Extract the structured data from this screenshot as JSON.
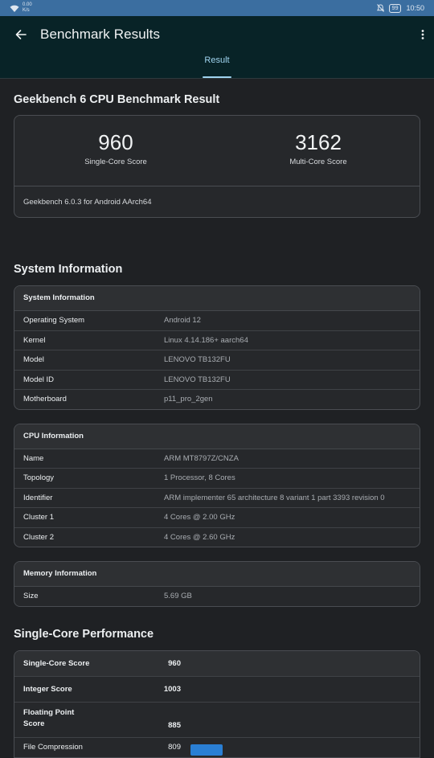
{
  "status": {
    "net_speed": "0.00",
    "net_unit": "K/s",
    "battery": "99",
    "time": "10:50"
  },
  "header": {
    "title": "Benchmark Results",
    "tab": "Result"
  },
  "result": {
    "heading": "Geekbench 6 CPU Benchmark Result",
    "single_score": "960",
    "single_label": "Single-Core Score",
    "multi_score": "3162",
    "multi_label": "Multi-Core Score",
    "version": "Geekbench 6.0.3 for Android AArch64"
  },
  "system": {
    "heading": "System Information",
    "card_title": "System Information",
    "rows": [
      {
        "k": "Operating System",
        "v": "Android 12"
      },
      {
        "k": "Kernel",
        "v": "Linux 4.14.186+ aarch64"
      },
      {
        "k": "Model",
        "v": "LENOVO TB132FU"
      },
      {
        "k": "Model ID",
        "v": "LENOVO TB132FU"
      },
      {
        "k": "Motherboard",
        "v": "p11_pro_2gen"
      }
    ]
  },
  "cpu": {
    "card_title": "CPU Information",
    "rows": [
      {
        "k": "Name",
        "v": "ARM MT8797Z/CNZA"
      },
      {
        "k": "Topology",
        "v": "1 Processor, 8 Cores"
      },
      {
        "k": "Identifier",
        "v": "ARM implementer 65 architecture 8 variant 1 part 3393 revision 0"
      },
      {
        "k": "Cluster 1",
        "v": "4 Cores @ 2.00 GHz"
      },
      {
        "k": "Cluster 2",
        "v": "4 Cores @ 2.60 GHz"
      }
    ]
  },
  "memory": {
    "card_title": "Memory Information",
    "rows": [
      {
        "k": "Size",
        "v": "5.69 GB"
      }
    ]
  },
  "single_core": {
    "heading": "Single-Core Performance",
    "rows": [
      {
        "k": "Single-Core Score",
        "v": "960"
      },
      {
        "k": "Integer Score",
        "v": "1003"
      },
      {
        "k": "Floating Point Score",
        "k1": "Floating Point",
        "k2": "Score",
        "v": "885"
      },
      {
        "k": "File Compression",
        "v": "809"
      }
    ]
  },
  "colors": {
    "accent": "#9fd3ef",
    "appbar": "#082327",
    "bar": "#2a7fd4"
  }
}
